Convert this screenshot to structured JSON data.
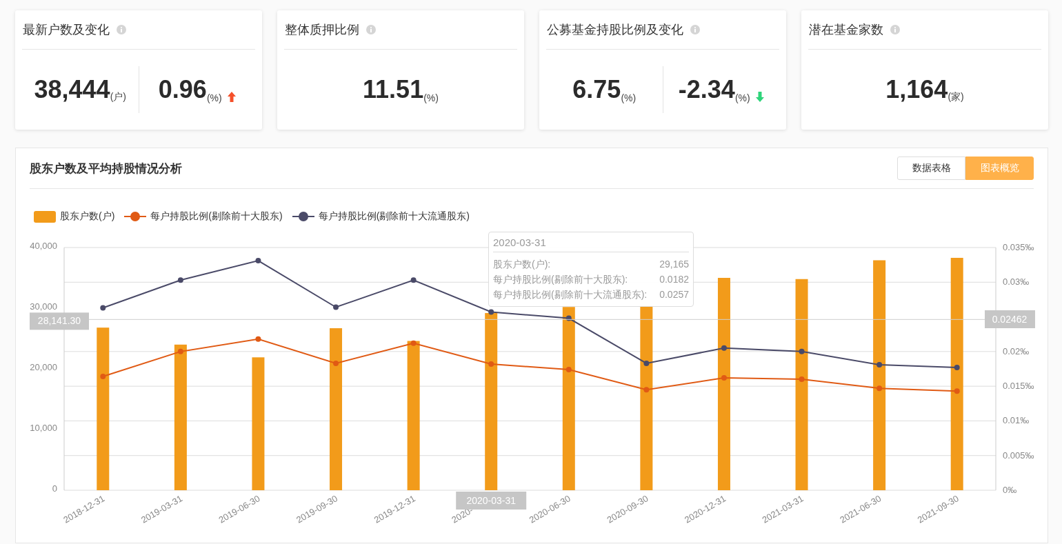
{
  "cards": [
    {
      "title": "最新户数及变化",
      "metrics": [
        {
          "value": "38,444",
          "unit": "(户)",
          "kind": "plain"
        },
        {
          "value": "0.96",
          "unit": "(%)",
          "kind": "rise"
        }
      ]
    },
    {
      "title": "整体质押比例",
      "metrics": [
        {
          "value": "11.51",
          "unit": "(%)",
          "kind": "plain"
        }
      ]
    },
    {
      "title": "公募基金持股比例及变化",
      "metrics": [
        {
          "value": "6.75",
          "unit": "(%)",
          "kind": "plain"
        },
        {
          "value": "-2.34",
          "unit": "(%)",
          "kind": "fall"
        }
      ]
    },
    {
      "title": "潜在基金家数",
      "metrics": [
        {
          "value": "1,164",
          "unit": "(家)",
          "kind": "plain"
        }
      ]
    }
  ],
  "panel": {
    "title": "股东户数及平均持股情况分析",
    "views": [
      {
        "label": "数据表格",
        "selected": false
      },
      {
        "label": "图表概览",
        "selected": true
      }
    ],
    "pointer": {
      "right_label": "0.02462",
      "bottom_label": "2020-03-31"
    },
    "tooltip": {
      "title": "2020-03-31",
      "rows": [
        {
          "label": "股东户数(户):",
          "value": "29,165"
        },
        {
          "label": "每户持股比例(剔除前十大股东):",
          "value": "0.0182"
        },
        {
          "label": "每户持股比例(剔除前十大流通股东):",
          "value": "0.0257"
        }
      ]
    },
    "chart_data": {
      "type": "bar",
      "grid": true,
      "ref_lines": [
        {
          "axis": "y",
          "value": 28141.3,
          "label": "28,141.30"
        }
      ],
      "categories": [
        "2018-12-31",
        "2019-03-31",
        "2019-06-30",
        "2019-09-30",
        "2019-12-31",
        "2020-",
        "2020-06-30",
        "2020-09-30",
        "2020-12-31",
        "2021-03-31",
        "2021-06-30",
        "2021-09-30"
      ],
      "ylim": [
        0,
        40000
      ],
      "yticks": [
        {
          "value": 0,
          "label": "0"
        },
        {
          "value": 10000,
          "label": "10,000"
        },
        {
          "value": 20000,
          "label": "20,000"
        },
        {
          "value": 30000,
          "label": "30,000"
        },
        {
          "value": 40000,
          "label": "40,000"
        }
      ],
      "y2lim": [
        0,
        0.035
      ],
      "y2ticks": [
        {
          "value": 0,
          "label": "0‰"
        },
        {
          "value": 0.005,
          "label": "0.005‰"
        },
        {
          "value": 0.01,
          "label": "0.01‰"
        },
        {
          "value": 0.015,
          "label": "0.015‰"
        },
        {
          "value": 0.02,
          "label": "0.02‰"
        },
        {
          "value": 0.03,
          "label": "0.03‰"
        },
        {
          "value": 0.035,
          "label": "0.035‰"
        }
      ],
      "series": [
        {
          "name": "股东户数(户)",
          "type": "bar",
          "color": "#f29b1a",
          "values": [
            26800,
            24000,
            21900,
            26700,
            24600,
            29200,
            30200,
            30300,
            35000,
            34800,
            37900,
            38300
          ]
        },
        {
          "name": "每户持股比例(剔除前十大股东)",
          "type": "line",
          "axis": "y2",
          "marker": true,
          "color": "#e05a14",
          "values": [
            0.0164,
            0.02,
            0.0218,
            0.0183,
            0.0212,
            0.0182,
            0.0174,
            0.0145,
            0.0162,
            0.016,
            0.0147,
            0.0143
          ]
        },
        {
          "name": "每户持股比例(剔除前十大流通股东)",
          "type": "line",
          "axis": "y2",
          "marker": true,
          "color": "#4a4a68",
          "values": [
            0.0263,
            0.0303,
            0.0331,
            0.0264,
            0.0303,
            0.0257,
            0.0248,
            0.0183,
            0.0205,
            0.02,
            0.0181,
            0.0177
          ]
        }
      ]
    }
  }
}
